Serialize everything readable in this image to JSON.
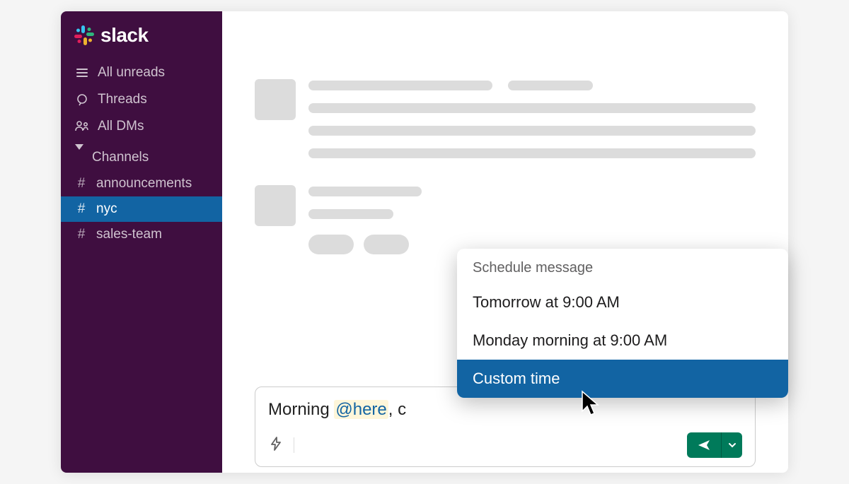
{
  "brand": {
    "name": "slack"
  },
  "sidebar": {
    "nav": [
      {
        "label": "All unreads",
        "icon": "list-icon"
      },
      {
        "label": "Threads",
        "icon": "threads-icon"
      },
      {
        "label": "All DMs",
        "icon": "dms-icon"
      }
    ],
    "channels_header": "Channels",
    "channels": [
      {
        "name": "announcements"
      },
      {
        "name": "nyc",
        "active": true
      },
      {
        "name": "sales-team"
      }
    ]
  },
  "composer": {
    "prefix": "Morning ",
    "mention": "@here",
    "suffix": ", c"
  },
  "schedule_menu": {
    "title": "Schedule message",
    "options": [
      {
        "label": "Tomorrow at 9:00 AM"
      },
      {
        "label": "Monday morning at 9:00 AM"
      },
      {
        "label": "Custom time",
        "highlight": true
      }
    ]
  },
  "colors": {
    "sidebar_bg": "#3f0e40",
    "accent_blue": "#1264a3",
    "send_green": "#007a5a"
  }
}
